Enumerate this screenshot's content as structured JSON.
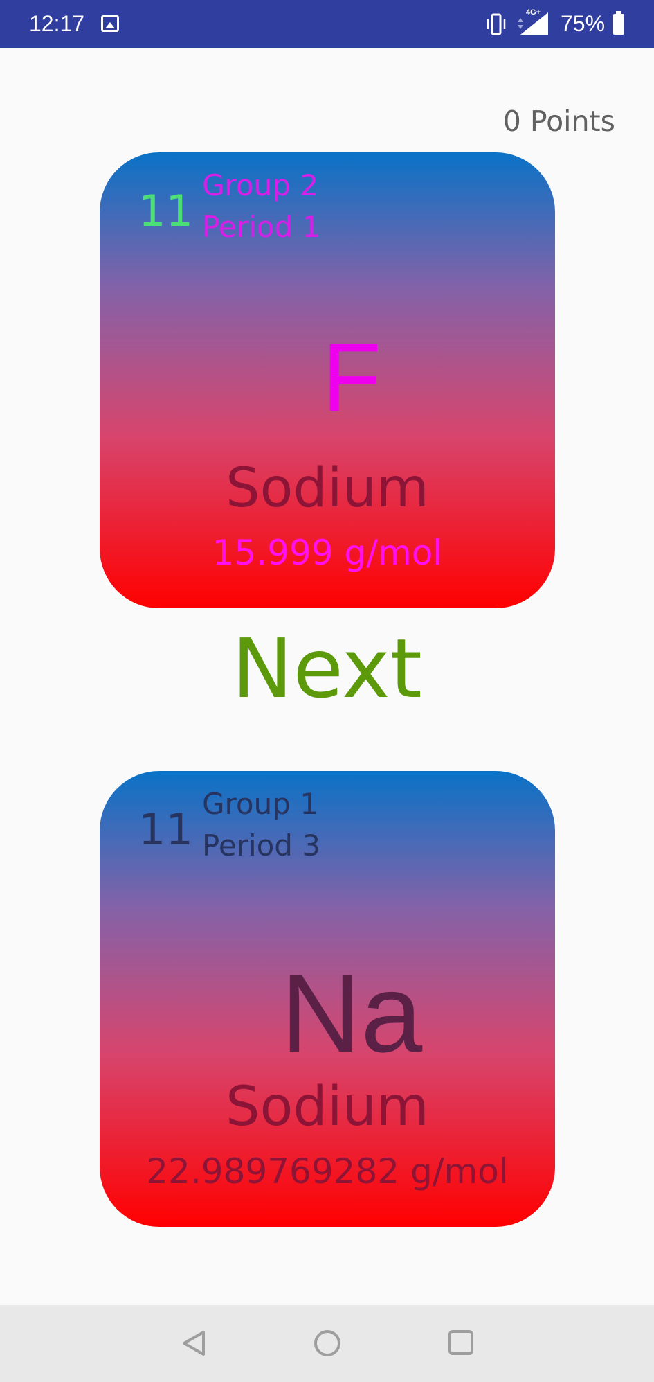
{
  "status_bar": {
    "time": "12:17",
    "network": "4G+",
    "battery_percent": "75%",
    "icons": [
      "image-icon",
      "vibrate-icon",
      "signal-icon",
      "battery-icon"
    ]
  },
  "score": {
    "points_label": "0 Points"
  },
  "question_card": {
    "atomic_number": "11",
    "group": "Group 2",
    "period": "Period 1",
    "symbol": "F",
    "name": "Sodium",
    "atomic_mass": "15.999 g/mol"
  },
  "next_button": {
    "label": "Next",
    "color": "#5c9a0c"
  },
  "answer_card": {
    "atomic_number": "11",
    "group": "Group 1",
    "period": "Period 3",
    "symbol": "Na",
    "name": "Sodium",
    "atomic_mass": "22.989769282 g/mol"
  },
  "nav_bar": {
    "icons": [
      "back-icon",
      "home-icon",
      "recents-icon"
    ]
  },
  "colors": {
    "status_bar": "#303f9f",
    "card_gradient_top": "#0a72c6",
    "card_gradient_bottom": "#ff0000"
  }
}
